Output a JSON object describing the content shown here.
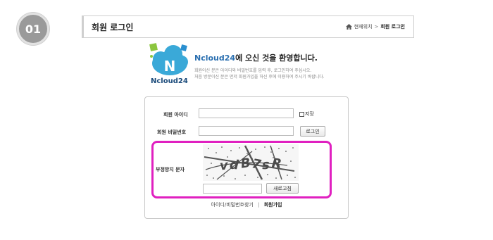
{
  "step": {
    "number": "01"
  },
  "header": {
    "title": "회원 로그인",
    "breadcrumb": {
      "prefix": "현재위치",
      "separator": ">",
      "current": "회원 로그인"
    }
  },
  "brand": {
    "logo_text": "Ncloud24",
    "welcome_brand": "Ncloud24",
    "welcome_rest": "에 오신 것을 환영합니다.",
    "subtext_line1": "회원이신 분은 아이디와 비밀번호를 입력 후, 로그인하여 주십시오.",
    "subtext_line2": "처음 방문이신 분은 먼저 회원가입을 하신 후에 이용하여 주시기 바랍니다."
  },
  "login": {
    "id_label": "회원 아이디",
    "id_value": "",
    "save_label": "저장",
    "password_label": "회원 비밀번호",
    "password_value": "",
    "login_button": "로그인",
    "captcha_label": "부정방지 문자",
    "captcha_input_value": "",
    "refresh_button": "새로고침"
  },
  "footer": {
    "find_link": "아이디/비밀번호찾기",
    "separator": "|",
    "signup_link": "회원가입"
  },
  "colors": {
    "highlight": "#e020c0",
    "brand_blue": "#2a6fb0",
    "badge_gray": "#9a9a9a"
  }
}
